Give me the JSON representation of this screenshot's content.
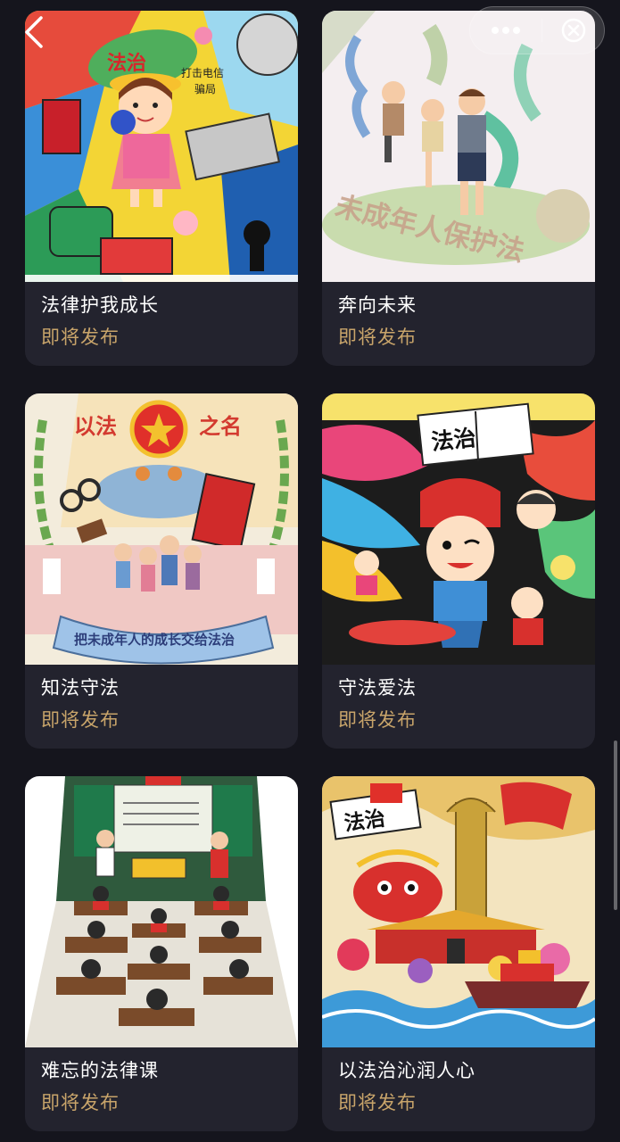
{
  "nav": {
    "back_icon": "chevron-left-icon",
    "more_icon": "more-dots-icon",
    "close_icon": "close-circle-icon"
  },
  "cards": [
    {
      "title": "法律护我成长",
      "status": "即将发布"
    },
    {
      "title": "奔向未来",
      "status": "即将发布"
    },
    {
      "title": "知法守法",
      "status": "即将发布"
    },
    {
      "title": "守法爱法",
      "status": "即将发布"
    },
    {
      "title": "难忘的法律课",
      "status": "即将发布"
    },
    {
      "title": "以法治沁润人心",
      "status": "即将发布"
    }
  ],
  "artwork_text": {
    "card1": {
      "fazhi": "法治",
      "fraud": "打击电信",
      "fraud2": "骗局"
    },
    "card2": {
      "slogan": "未成年人保护法"
    },
    "card3": {
      "top_left": "以法",
      "top_right": "之名",
      "banner": "把未成年人的成长交给法治"
    },
    "card4": {
      "book": "法治"
    },
    "card6": {
      "book": "法治"
    }
  },
  "colors": {
    "background": "#15151d",
    "card": "#23232e",
    "title": "#ffffff",
    "status": "#c8a46a"
  }
}
